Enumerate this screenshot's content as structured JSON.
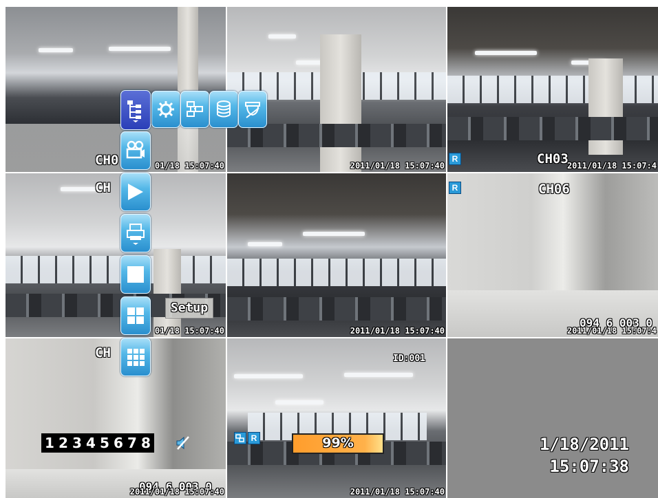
{
  "timestamps": {
    "ts1": "01/18 15:07:40",
    "ts2": "2011/01/18 15:07:40",
    "ts3": "2011/01/18 15:07:4",
    "ts4": "01/18 15:07:40",
    "ts5": "2011/01/18 15:07:40",
    "ts6": "2011/01/18 15:07:4",
    "ts7": "2011/01/18 15:07:40",
    "ts8": "2011/01/18 15:07:40"
  },
  "channels": {
    "ch1": "CH0",
    "ch3": "CH03",
    "ch4": "CH",
    "ch6": "CH06",
    "ch7": "CH"
  },
  "overlays": {
    "record_badge": "R",
    "plate6": "094 6 003 0",
    "plate7": "094 6 003 0",
    "id_label": "ID:001",
    "progress_text": "99%",
    "progress_value": 0.99,
    "clock_date": "1/18/2011",
    "clock_time": "15:07:38",
    "setup_tooltip": "Setup"
  },
  "channel_numbers": [
    "1",
    "2",
    "3",
    "4",
    "5",
    "6",
    "7",
    "8"
  ],
  "menu": {
    "vertical": [
      "tree-icon",
      "camera-icon",
      "play-icon",
      "printer-icon",
      "single-view-icon",
      "quad-view-icon",
      "grid-9-icon"
    ],
    "horizontal": [
      "gear-icon",
      "network-icon",
      "storage-icon",
      "ptz-icon"
    ]
  }
}
